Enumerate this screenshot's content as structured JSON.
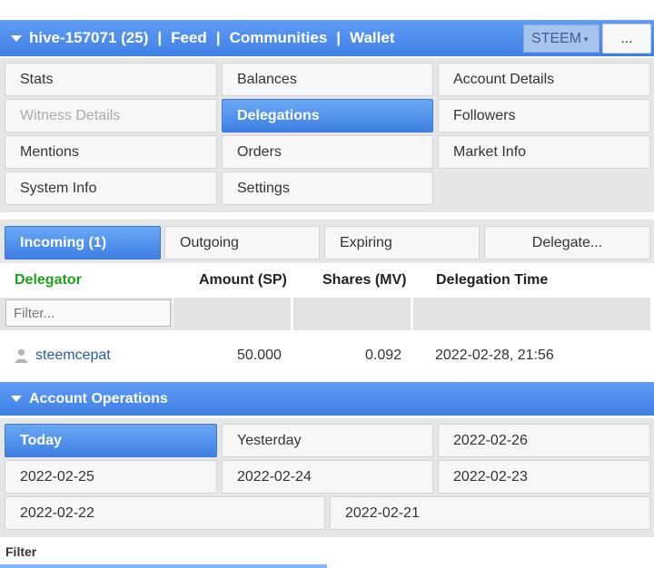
{
  "header": {
    "account": "hive-157071 (25)",
    "links": [
      "Feed",
      "Communities",
      "Wallet"
    ],
    "separator": "|",
    "chain_select": "STEEM",
    "more_button": "..."
  },
  "nav": {
    "items": [
      {
        "label": "Stats",
        "state": "normal"
      },
      {
        "label": "Balances",
        "state": "normal"
      },
      {
        "label": "Account Details",
        "state": "normal"
      },
      {
        "label": "Witness Details",
        "state": "disabled"
      },
      {
        "label": "Delegations",
        "state": "active"
      },
      {
        "label": "Followers",
        "state": "normal"
      },
      {
        "label": "Mentions",
        "state": "normal"
      },
      {
        "label": "Orders",
        "state": "normal"
      },
      {
        "label": "Market Info",
        "state": "normal"
      },
      {
        "label": "System Info",
        "state": "normal"
      },
      {
        "label": "Settings",
        "state": "normal"
      }
    ]
  },
  "delegation_tabs": [
    {
      "label": "Incoming (1)",
      "active": true
    },
    {
      "label": "Outgoing",
      "active": false
    },
    {
      "label": "Expiring",
      "active": false
    },
    {
      "label": "Delegate...",
      "active": false
    }
  ],
  "table": {
    "headers": [
      "Delegator",
      "Amount (SP)",
      "Shares (MV)",
      "Delegation Time"
    ],
    "filter_placeholder": "Filter...",
    "rows": [
      {
        "delegator": "steemcepat",
        "amount": "50.000",
        "shares": "0.092",
        "time": "2022-02-28, 21:56"
      }
    ]
  },
  "operations": {
    "title": "Account Operations",
    "days": [
      "Today",
      "Yesterday",
      "2022-02-26",
      "2022-02-25",
      "2022-02-24",
      "2022-02-23",
      "2022-02-22",
      "2022-02-21"
    ],
    "filter_label": "Filter"
  },
  "colors": {
    "accent": "#3f80e6",
    "delegator_header": "#1ca11c",
    "link": "#2a5b9e"
  }
}
